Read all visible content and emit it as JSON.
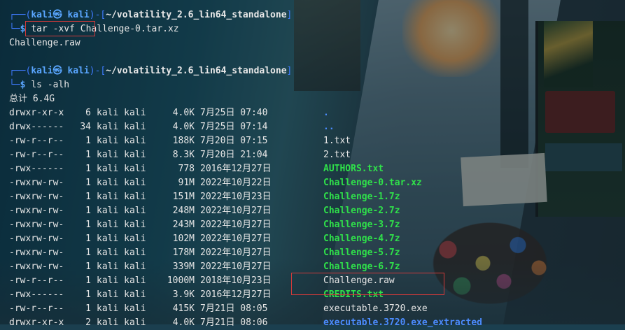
{
  "prompt1": {
    "user_host": "kali㉿ kali",
    "path": "~/volatility_2.6_lin64_standalone",
    "command": "tar -xvf Challenge-0.tar.xz"
  },
  "output1": "Challenge.raw",
  "prompt2": {
    "user_host": "kali㉿ kali",
    "path": "~/volatility_2.6_lin64_standalone",
    "command": "ls -alh"
  },
  "total_line": "总计 6.4G",
  "listing": [
    {
      "perms": "drwxr-xr-x",
      "links": "6",
      "owner": "kali kali",
      "size": "4.0K",
      "date": "7月25日 07:40",
      "name": ".",
      "kind": "dir"
    },
    {
      "perms": "drwx------",
      "links": "34",
      "owner": "kali kali",
      "size": "4.0K",
      "date": "7月25日 07:14",
      "name": "..",
      "kind": "dir"
    },
    {
      "perms": "-rw-r--r--",
      "links": "1",
      "owner": "kali kali",
      "size": "188K",
      "date": "7月20日 07:15",
      "name": "1.txt",
      "kind": "file"
    },
    {
      "perms": "-rw-r--r--",
      "links": "1",
      "owner": "kali kali",
      "size": "8.3K",
      "date": "7月20日 21:04",
      "name": "2.txt",
      "kind": "file"
    },
    {
      "perms": "-rwx------",
      "links": "1",
      "owner": "kali kali",
      "size": "778",
      "date": "2016年12月27日",
      "name": "AUTHORS.txt",
      "kind": "exec"
    },
    {
      "perms": "-rwxrw-rw-",
      "links": "1",
      "owner": "kali kali",
      "size": "91M",
      "date": "2022年10月22日",
      "name": "Challenge-0.tar.xz",
      "kind": "exec"
    },
    {
      "perms": "-rwxrw-rw-",
      "links": "1",
      "owner": "kali kali",
      "size": "151M",
      "date": "2022年10月23日",
      "name": "Challenge-1.7z",
      "kind": "exec"
    },
    {
      "perms": "-rwxrw-rw-",
      "links": "1",
      "owner": "kali kali",
      "size": "248M",
      "date": "2022年10月27日",
      "name": "Challenge-2.7z",
      "kind": "exec"
    },
    {
      "perms": "-rwxrw-rw-",
      "links": "1",
      "owner": "kali kali",
      "size": "243M",
      "date": "2022年10月27日",
      "name": "Challenge-3.7z",
      "kind": "exec"
    },
    {
      "perms": "-rwxrw-rw-",
      "links": "1",
      "owner": "kali kali",
      "size": "102M",
      "date": "2022年10月27日",
      "name": "Challenge-4.7z",
      "kind": "exec"
    },
    {
      "perms": "-rwxrw-rw-",
      "links": "1",
      "owner": "kali kali",
      "size": "178M",
      "date": "2022年10月27日",
      "name": "Challenge-5.7z",
      "kind": "exec"
    },
    {
      "perms": "-rwxrw-rw-",
      "links": "1",
      "owner": "kali kali",
      "size": "339M",
      "date": "2022年10月27日",
      "name": "Challenge-6.7z",
      "kind": "exec"
    },
    {
      "perms": "-rw-r--r--",
      "links": "1",
      "owner": "kali kali",
      "size": "1000M",
      "date": "2018年10月23日",
      "name": "Challenge.raw",
      "kind": "file"
    },
    {
      "perms": "-rwx------",
      "links": "1",
      "owner": "kali kali",
      "size": "3.9K",
      "date": "2016年12月27日",
      "name": "CREDITS.txt",
      "kind": "exec"
    },
    {
      "perms": "-rw-r--r--",
      "links": "1",
      "owner": "kali kali",
      "size": "415K",
      "date": "7月21日 08:05",
      "name": "executable.3720.exe",
      "kind": "file"
    },
    {
      "perms": "drwxr-xr-x",
      "links": "2",
      "owner": "kali kali",
      "size": "4.0K",
      "date": "7月21日 08:06",
      "name": "executable.3720.exe_extracted",
      "kind": "dir"
    }
  ],
  "colors": {
    "prompt_frame": "#3f7bff",
    "user_host": "#5aa6ff",
    "directory": "#4b8cff",
    "executable": "#2fe04a",
    "highlight_box": "#d03a3a"
  }
}
